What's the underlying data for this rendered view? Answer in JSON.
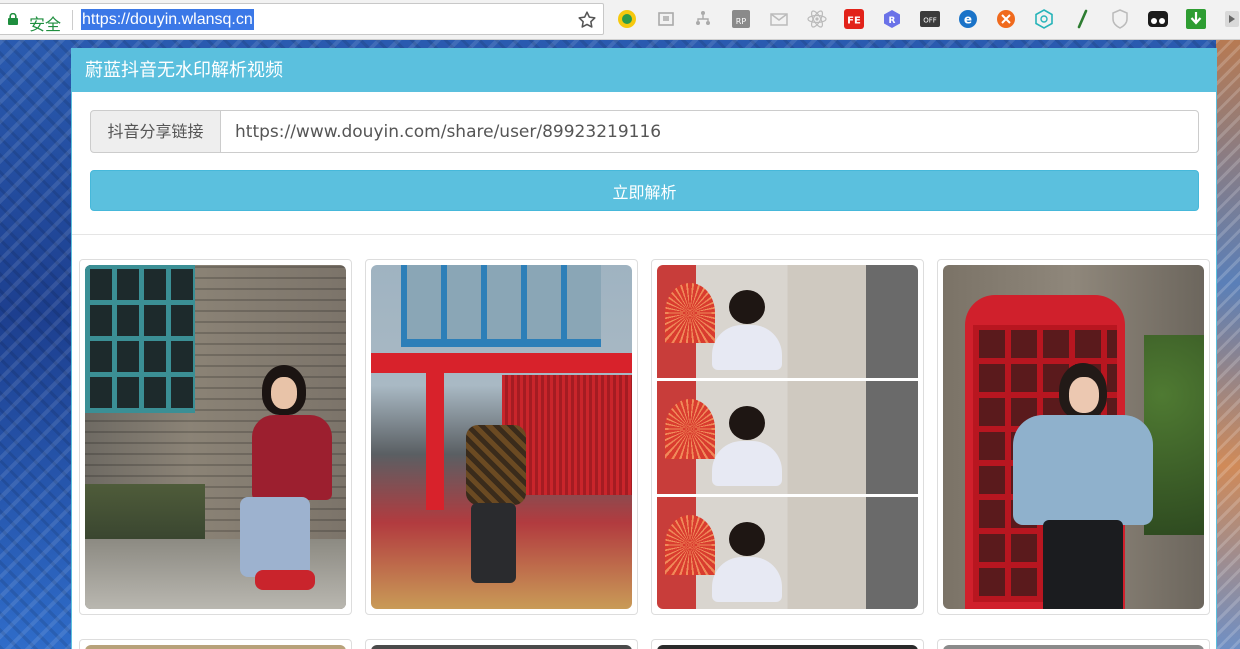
{
  "browser": {
    "security_label": "安全",
    "url": "https://douyin.wlansq.cn",
    "extensions": [
      "smiley-extension-icon",
      "frame-extension-icon",
      "tree-extension-icon",
      "rp-extension-icon",
      "envelope-extension-icon",
      "react-extension-icon",
      "fe-extension-icon",
      "r-extension-icon",
      "off-extension-icon",
      "ie-extension-icon",
      "orange-extension-icon",
      "hexagon-extension-icon",
      "slash-extension-icon",
      "shield-extension-icon",
      "tampermonkey-extension-icon",
      "download-extension-icon",
      "play-extension-icon"
    ]
  },
  "panel": {
    "title": "蔚蓝抖音无水印解析视频",
    "input_addon": "抖音分享链接",
    "input_value": "https://www.douyin.com/share/user/89923219116",
    "submit_label": "立即解析"
  },
  "colors": {
    "accent": "#5bc0de",
    "secure_green": "#1e8e3e",
    "url_highlight": "#3b78e7"
  }
}
